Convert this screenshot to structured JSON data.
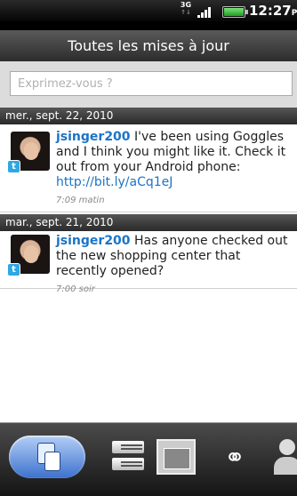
{
  "status_bar": {
    "network": "3G",
    "time": "12:27",
    "ampm": "PM"
  },
  "header": {
    "title": "Toutes les mises à jour"
  },
  "composer": {
    "placeholder": "Exprimez-vous ?"
  },
  "feed": [
    {
      "date": "mer., sept. 22, 2010",
      "user": "jsinger200",
      "text": " I've been using Goggles and I think you might like it. Check it out from your Android phone: ",
      "link": "http://bit.ly/aCq1eJ",
      "time": "7:09 matin",
      "service_icon": "twitter-icon"
    },
    {
      "date": "mar., sept. 21, 2010",
      "user": "jsinger200",
      "text": " Has anyone checked out the new shopping center that recently opened?",
      "link": "",
      "time": "7:00 soir",
      "service_icon": "twitter-icon"
    }
  ],
  "tabs": [
    "people-icon",
    "messages-icon",
    "gallery-icon",
    "link-icon",
    "person-icon"
  ],
  "colors": {
    "accent": "#1a74c7",
    "twitter": "#2fa7e3"
  }
}
